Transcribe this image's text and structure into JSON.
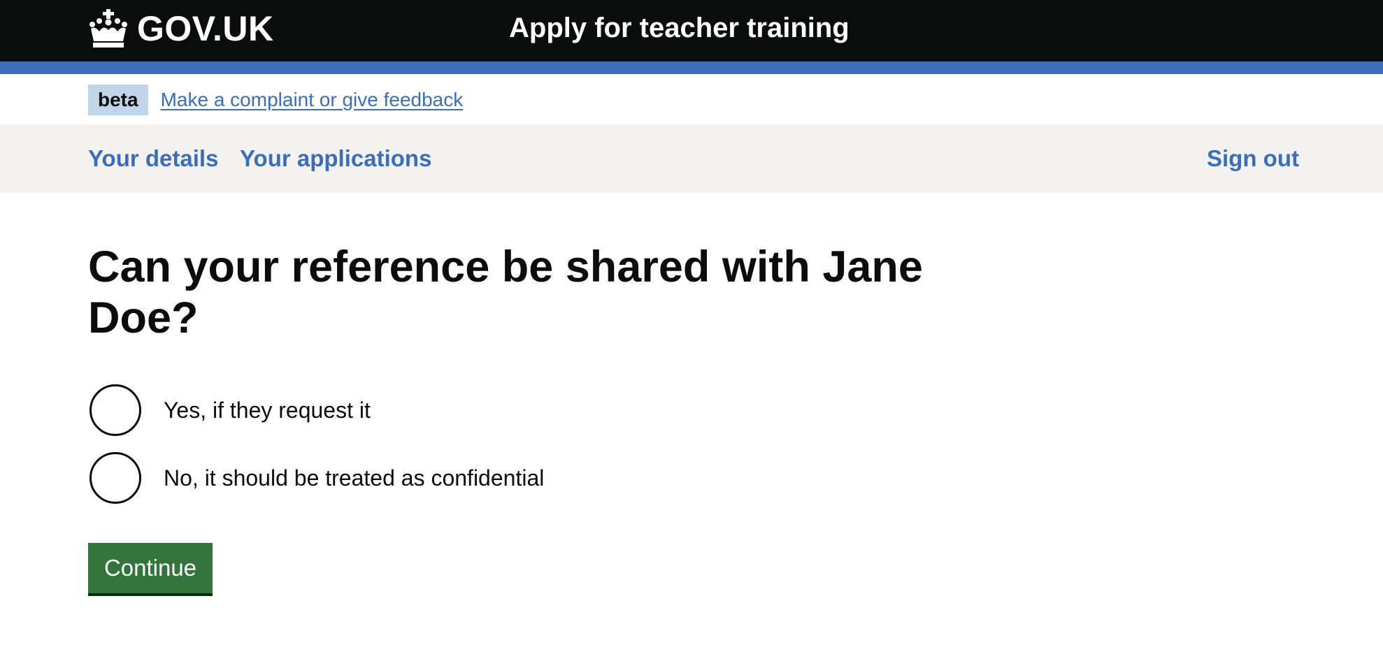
{
  "header": {
    "logo_text": "GOV.UK",
    "logo_icon": "crown-icon",
    "service_name": "Apply for teacher training"
  },
  "phase_banner": {
    "tag": "beta",
    "link": "Make a complaint or give feedback"
  },
  "nav": {
    "items": [
      "Your details",
      "Your applications"
    ],
    "sign_out": "Sign out"
  },
  "main": {
    "heading": "Can your reference be shared with Jane Doe?",
    "options": [
      "Yes, if they request it",
      "No, it should be treated as confidential"
    ],
    "submit_label": "Continue"
  },
  "colors": {
    "header_bg": "#0b0c0c",
    "accent_bar": "#3a6fb7",
    "link": "#3a6fb7",
    "nav_bg": "#f3f2f1",
    "tag_bg": "#c1d5ea",
    "button_bg": "#33743d"
  }
}
